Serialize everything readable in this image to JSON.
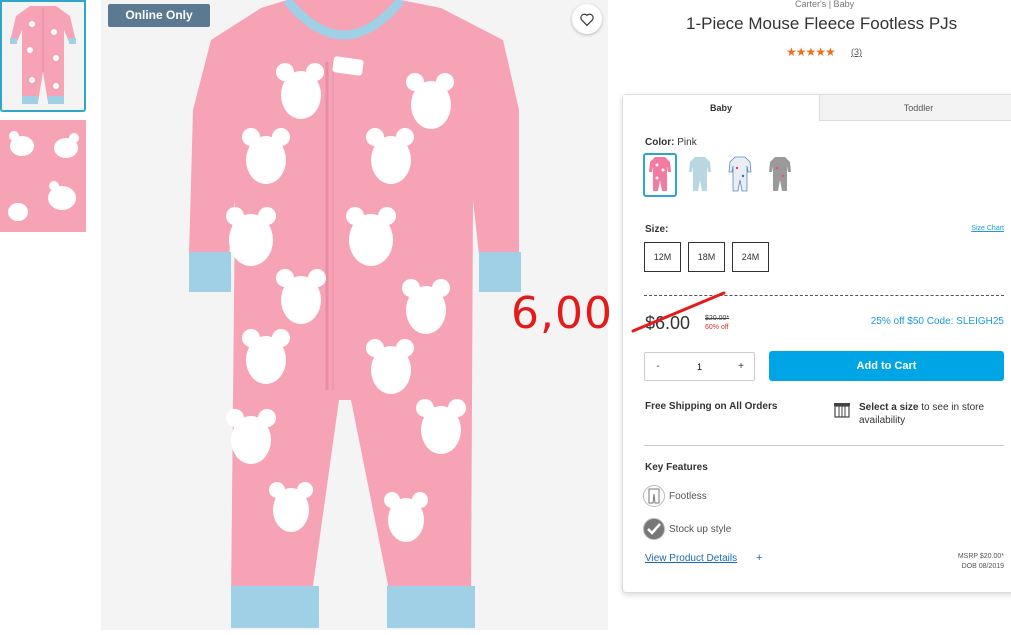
{
  "badge": {
    "online_only": "Online Only"
  },
  "product": {
    "brand": "Carter's | Baby",
    "title": "1-Piece Mouse Fleece Footless PJs",
    "stars": "★★★★★",
    "review_count": "(3)"
  },
  "tabs": {
    "baby": "Baby",
    "toddler": "Toddler"
  },
  "color": {
    "label": "Color:",
    "value": "Pink",
    "swatches": [
      "pink-mouse",
      "blue-stripe",
      "white-print",
      "grey-print"
    ]
  },
  "size": {
    "label": "Size:",
    "chart_link": "Size Chart",
    "options": [
      "12M",
      "18M",
      "24M"
    ]
  },
  "pricing": {
    "price": "$6.00",
    "original_price": "$20.00*",
    "percent_off": "60% off",
    "promo": "25% off $50 Code: SLEIGH25"
  },
  "cart": {
    "minus": "-",
    "quantity": "1",
    "plus": "+",
    "add_label": "Add to Cart"
  },
  "shipping": {
    "free_shipping": "Free Shipping on All Orders",
    "store_bold": "Select a size",
    "store_rest": " to see in store availability"
  },
  "features": {
    "title": "Key Features",
    "items": [
      "Footless",
      "Stock up style"
    ],
    "details_link": "View Product Details",
    "details_plus": "+",
    "msrp": "MSRP $20.00*",
    "dob": "DOB 08/2019"
  },
  "annotation": {
    "text": "6,00"
  },
  "colors": {
    "accent": "#00a5e6",
    "badge": "#5b7a91",
    "sale_red": "#d32f2f",
    "annotation_red": "#e31b1b",
    "garment_pink": "#f6a3b6",
    "cuff_blue": "#9fd0e6"
  }
}
